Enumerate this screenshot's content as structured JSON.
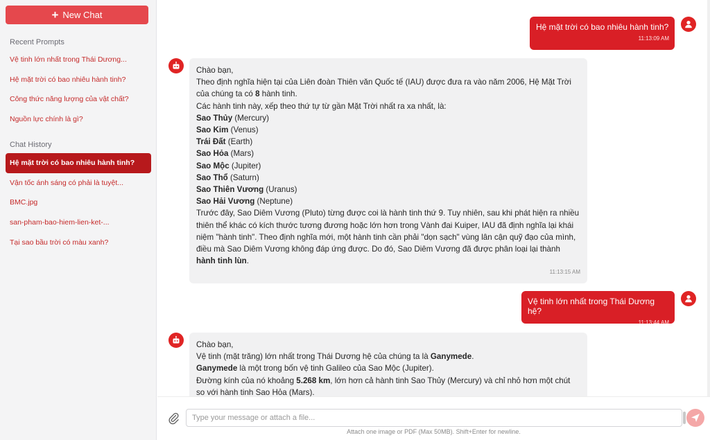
{
  "sidebar": {
    "new_chat_label": "New Chat",
    "recent_title": "Recent Prompts",
    "recent": [
      "Vệ tinh lớn nhất trong Thái Dương...",
      "Hệ mặt trời có bao nhiêu hành tinh?",
      "Công thức năng lượng của vật chất?",
      "Nguồn lực chính là gì?"
    ],
    "history_title": "Chat History",
    "history": [
      "Hệ mặt trời có bao nhiêu hành tinh?",
      "Vận tốc ánh sáng có phải là tuyệt...",
      "BMC.jpg",
      "san-pham-bao-hiem-lien-ket-...",
      "Tại sao bầu trời có màu xanh?"
    ]
  },
  "messages": {
    "m1": {
      "text": "Hệ mặt trời có bao nhiêu hành tinh?",
      "time": "11:13:09 AM"
    },
    "m2": {
      "greet": "Chào bạn,",
      "intro_a": "Theo định nghĩa hiện tại của Liên đoàn Thiên văn Quốc tế (IAU) được đưa ra vào năm 2006, Hệ Mặt Trời của chúng ta có ",
      "intro_num": "8",
      "intro_b": " hành tinh.",
      "order": "Các hành tinh này, xếp theo thứ tự từ gần Mặt Trời nhất ra xa nhất, là:",
      "planets": [
        {
          "vn": "Sao Thủy",
          "en": " (Mercury)"
        },
        {
          "vn": "Sao Kim",
          "en": " (Venus)"
        },
        {
          "vn": "Trái Đất",
          "en": " (Earth)"
        },
        {
          "vn": "Sao Hỏa",
          "en": " (Mars)"
        },
        {
          "vn": "Sao Mộc",
          "en": " (Jupiter)"
        },
        {
          "vn": "Sao Thổ",
          "en": " (Saturn)"
        },
        {
          "vn": "Sao Thiên Vương",
          "en": " (Uranus)"
        },
        {
          "vn": "Sao Hải Vương",
          "en": " (Neptune)"
        }
      ],
      "pluto_a": "Trước đây, Sao Diêm Vương (Pluto) từng được coi là hành tinh thứ 9. Tuy nhiên, sau khi phát hiện ra nhiều thiên thể khác có kích thước tương đương hoặc lớn hơn trong Vành đai Kuiper, IAU đã định nghĩa lại khái niệm \"hành tinh\". Theo định nghĩa mới, một hành tinh cần phải \"dọn sạch\" vùng lân cận quỹ đạo của mình, điều mà Sao Diêm Vương không đáp ứng được. Do đó, Sao Diêm Vương đã được phân loại lại thành ",
      "pluto_bold": "hành tinh lùn",
      "pluto_end": ".",
      "time": "11:13:15 AM"
    },
    "m3": {
      "text": "Vệ tinh lớn nhất trong Thái Dương hệ?",
      "time": "11:13:44 AM"
    },
    "m4": {
      "greet": "Chào bạn,",
      "l1a": "Vệ tinh (mặt trăng) lớn nhất trong Thái Dương hệ của chúng ta là ",
      "l1b": "Ganymede",
      "l1c": ".",
      "l2a": "Ganymede",
      "l2b": " là một trong bốn vệ tinh Galileo của Sao Mộc (Jupiter).",
      "l3a": "Đường kính của nó khoảng ",
      "l3b": "5.268 km",
      "l3c": ", lớn hơn cả hành tinh Sao Thủy (Mercury) và chỉ nhỏ hơn một chút so với hành tinh Sao Hỏa (Mars)."
    }
  },
  "composer": {
    "placeholder": "Type your message or attach a file...",
    "hint": "Attach one image or PDF (Max 50MB). Shift+Enter for newline."
  },
  "colors": {
    "accent": "#e5484d",
    "user_bubble": "#d91f26",
    "active_item": "#b7191c"
  }
}
